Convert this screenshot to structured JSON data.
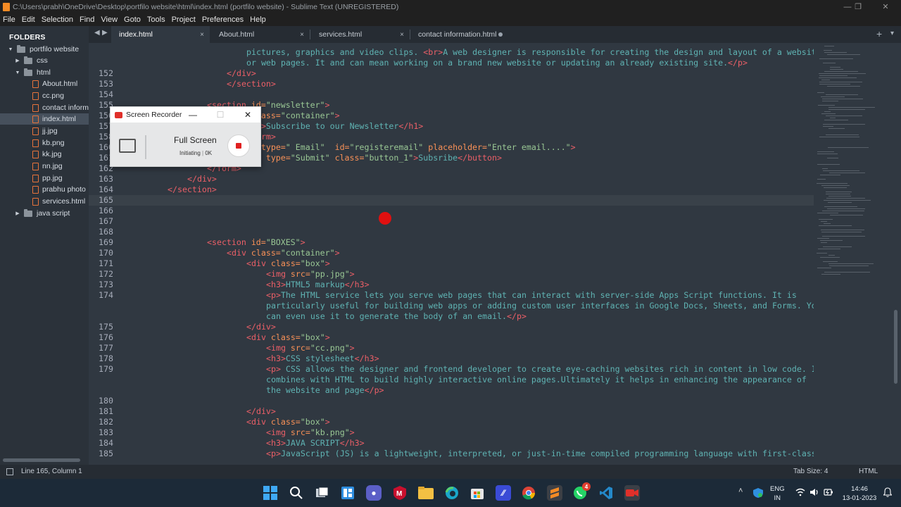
{
  "window": {
    "title": "C:\\Users\\prabh\\OneDrive\\Desktop\\portfilo website\\html\\index.html (portfilo website) - Sublime Text (UNREGISTERED)"
  },
  "menu": [
    "File",
    "Edit",
    "Selection",
    "Find",
    "View",
    "Goto",
    "Tools",
    "Project",
    "Preferences",
    "Help"
  ],
  "sidebar": {
    "header": "FOLDERS",
    "items": [
      {
        "label": "portfilo website",
        "type": "folder",
        "expanded": true
      },
      {
        "label": "css",
        "type": "folder",
        "expanded": false
      },
      {
        "label": "html",
        "type": "folder",
        "expanded": true
      },
      {
        "label": "About.html",
        "type": "html"
      },
      {
        "label": "cc.png",
        "type": "image"
      },
      {
        "label": "contact inform",
        "type": "html"
      },
      {
        "label": "index.html",
        "type": "html",
        "selected": true
      },
      {
        "label": "jj.jpg",
        "type": "image"
      },
      {
        "label": "kb.png",
        "type": "image"
      },
      {
        "label": "kk.jpg",
        "type": "image"
      },
      {
        "label": "nn.jpg",
        "type": "image"
      },
      {
        "label": "pp.jpg",
        "type": "image"
      },
      {
        "label": "prabhu photo",
        "type": "image"
      },
      {
        "label": "services.html",
        "type": "html"
      },
      {
        "label": "java script",
        "type": "folder",
        "expanded": false
      }
    ]
  },
  "tabs": [
    {
      "label": "index.html",
      "active": true,
      "control": "×"
    },
    {
      "label": "About.html",
      "active": false,
      "control": "×"
    },
    {
      "label": "services.html",
      "active": false,
      "control": "×"
    },
    {
      "label": "contact information.html",
      "active": false,
      "control": "dirty-dot"
    }
  ],
  "editor": {
    "lines": [
      {
        "num": "",
        "segs": [
          [
            "p",
            "pictures, graphics and video clips. "
          ],
          [
            "t",
            "<br>"
          ],
          [
            "p",
            "A web designer is responsible for creating the design and layout of a website"
          ]
        ],
        "ind": 24
      },
      {
        "num": "",
        "segs": [
          [
            "p",
            "or web pages. It and can mean working on a brand new website or updating an already existing site."
          ],
          [
            "t",
            "</p>"
          ]
        ],
        "ind": 24
      },
      {
        "num": "152",
        "segs": [
          [
            "t",
            "</div>"
          ]
        ],
        "ind": 20
      },
      {
        "num": "153",
        "segs": [
          [
            "t",
            "</section>"
          ]
        ],
        "ind": 20
      },
      {
        "num": "154",
        "segs": [],
        "ind": 0
      },
      {
        "num": "155",
        "segs": [
          [
            "t",
            "<section "
          ],
          [
            "a",
            "id="
          ],
          [
            "s",
            "\"newsletter\""
          ],
          [
            "t",
            ">"
          ]
        ],
        "ind": 16
      },
      {
        "num": "156",
        "segs": [
          [
            "t",
            "<div "
          ],
          [
            "a",
            "class="
          ],
          [
            "s",
            "\"container\""
          ],
          [
            "t",
            ">"
          ]
        ],
        "ind": 20
      },
      {
        "num": "157",
        "segs": [
          [
            "t",
            "<h1>"
          ],
          [
            "p",
            "Subscribe to our Newsletter"
          ],
          [
            "t",
            "</h1>"
          ]
        ],
        "ind": 24
      },
      {
        "num": "158",
        "segs": [
          [
            "t",
            "<form>"
          ]
        ],
        "ind": 24
      },
      {
        "num": "160",
        "segs": [
          [
            "t",
            "<input "
          ],
          [
            "a",
            "type="
          ],
          [
            "s",
            "\" Email\"  "
          ],
          [
            "a",
            "id="
          ],
          [
            "s",
            "\"registeremail\" "
          ],
          [
            "a",
            "placeholder="
          ],
          [
            "s",
            "\"Enter email....\""
          ],
          [
            "t",
            ">"
          ]
        ],
        "ind": 20
      },
      {
        "num": "161",
        "segs": [
          [
            "t",
            "<button "
          ],
          [
            "a",
            "type="
          ],
          [
            "s",
            "\"Submit\" "
          ],
          [
            "a",
            "class="
          ],
          [
            "s",
            "\"button_1\""
          ],
          [
            "t",
            ">"
          ],
          [
            "p",
            "Subsribe"
          ],
          [
            "t",
            "</button>"
          ]
        ],
        "ind": 20
      },
      {
        "num": "162",
        "segs": [
          [
            "t",
            "</form>"
          ]
        ],
        "ind": 16
      },
      {
        "num": "163",
        "segs": [
          [
            "t",
            "</div>"
          ]
        ],
        "ind": 12
      },
      {
        "num": "164",
        "segs": [
          [
            "t",
            "</section>"
          ]
        ],
        "ind": 8
      },
      {
        "num": "165",
        "segs": [],
        "ind": 0,
        "current": true
      },
      {
        "num": "166",
        "segs": [],
        "ind": 0
      },
      {
        "num": "167",
        "segs": [],
        "ind": 0
      },
      {
        "num": "168",
        "segs": [],
        "ind": 0
      },
      {
        "num": "169",
        "segs": [
          [
            "t",
            "<section "
          ],
          [
            "a",
            "id="
          ],
          [
            "s",
            "\"BOXES\""
          ],
          [
            "t",
            ">"
          ]
        ],
        "ind": 16
      },
      {
        "num": "170",
        "segs": [
          [
            "t",
            "<div "
          ],
          [
            "a",
            "class="
          ],
          [
            "s",
            "\"container\""
          ],
          [
            "t",
            ">"
          ]
        ],
        "ind": 20
      },
      {
        "num": "171",
        "segs": [
          [
            "t",
            "<div "
          ],
          [
            "a",
            "class="
          ],
          [
            "s",
            "\"box\""
          ],
          [
            "t",
            ">"
          ]
        ],
        "ind": 24
      },
      {
        "num": "172",
        "segs": [
          [
            "t",
            "<img "
          ],
          [
            "a",
            "src="
          ],
          [
            "s",
            "\"pp.jpg\""
          ],
          [
            "t",
            ">"
          ]
        ],
        "ind": 28
      },
      {
        "num": "173",
        "segs": [
          [
            "t",
            "<h3>"
          ],
          [
            "p",
            "HTML5 markup"
          ],
          [
            "t",
            "</h3>"
          ]
        ],
        "ind": 28
      },
      {
        "num": "174",
        "segs": [
          [
            "t",
            "<p>"
          ],
          [
            "p",
            "The HTML service lets you serve web pages that can interact with server-side Apps Script functions. It is"
          ]
        ],
        "ind": 28
      },
      {
        "num": "",
        "segs": [
          [
            "p",
            "particularly useful for building web apps or adding custom user interfaces in Google Docs, Sheets, and Forms. You"
          ]
        ],
        "ind": 28
      },
      {
        "num": "",
        "segs": [
          [
            "p",
            "can even use it to generate the body of an email."
          ],
          [
            "t",
            "</p>"
          ]
        ],
        "ind": 28
      },
      {
        "num": "175",
        "segs": [
          [
            "t",
            "</div>"
          ]
        ],
        "ind": 24
      },
      {
        "num": "176",
        "segs": [
          [
            "t",
            "<div "
          ],
          [
            "a",
            "class="
          ],
          [
            "s",
            "\"box\""
          ],
          [
            "t",
            ">"
          ]
        ],
        "ind": 24
      },
      {
        "num": "177",
        "segs": [
          [
            "t",
            "<img "
          ],
          [
            "a",
            "src="
          ],
          [
            "s",
            "\"cc.png\""
          ],
          [
            "t",
            ">"
          ]
        ],
        "ind": 28
      },
      {
        "num": "178",
        "segs": [
          [
            "t",
            "<h3>"
          ],
          [
            "p",
            "CSS stylesheet"
          ],
          [
            "t",
            "</h3>"
          ]
        ],
        "ind": 28
      },
      {
        "num": "179",
        "segs": [
          [
            "t",
            "<p>"
          ],
          [
            "p",
            " CSS allows the designer and frontend developer to create eye-caching websites rich in content in low code. It"
          ]
        ],
        "ind": 28
      },
      {
        "num": "",
        "segs": [
          [
            "p",
            "combines with HTML to build highly interactive online pages.Ultimately it helps in enhancing the appearance of"
          ]
        ],
        "ind": 28
      },
      {
        "num": "",
        "segs": [
          [
            "p",
            "the website and page"
          ],
          [
            "t",
            "</p>"
          ]
        ],
        "ind": 28
      },
      {
        "num": "180",
        "segs": [],
        "ind": 0
      },
      {
        "num": "181",
        "segs": [
          [
            "t",
            "</div>"
          ]
        ],
        "ind": 24
      },
      {
        "num": "182",
        "segs": [
          [
            "t",
            "<div "
          ],
          [
            "a",
            "class="
          ],
          [
            "s",
            "\"box\""
          ],
          [
            "t",
            ">"
          ]
        ],
        "ind": 24
      },
      {
        "num": "183",
        "segs": [
          [
            "t",
            "<img "
          ],
          [
            "a",
            "src="
          ],
          [
            "s",
            "\"kb.png\""
          ],
          [
            "t",
            ">"
          ]
        ],
        "ind": 28
      },
      {
        "num": "184",
        "segs": [
          [
            "t",
            "<h3>"
          ],
          [
            "p",
            "JAVA SCRIPT"
          ],
          [
            "t",
            "</h3>"
          ]
        ],
        "ind": 28
      },
      {
        "num": "185",
        "segs": [
          [
            "t",
            "<p>"
          ],
          [
            "p",
            "JavaScript (JS) is a lightweight, interpreted, or just-in-time compiled programming language with first-class"
          ]
        ],
        "ind": 28
      }
    ]
  },
  "status": {
    "position": "Line 165, Column 1",
    "tab_size": "Tab Size: 4",
    "syntax": "HTML"
  },
  "recorder": {
    "title": "Screen Recorder",
    "mode": "Full Screen",
    "state": "Initiating",
    "size": "0K",
    "minimize": "—",
    "maximize": "☐",
    "close": "✕"
  },
  "tray": {
    "lang_top": "ENG",
    "lang_bottom": "IN",
    "time": "14:46",
    "date": "13-01-2023",
    "whatsapp_badge": "4"
  },
  "colors": {
    "editor_bg": "#303841",
    "tag": "#ec5f67",
    "attr": "#f99157",
    "string": "#99c794",
    "text": "#5fb3b3"
  }
}
